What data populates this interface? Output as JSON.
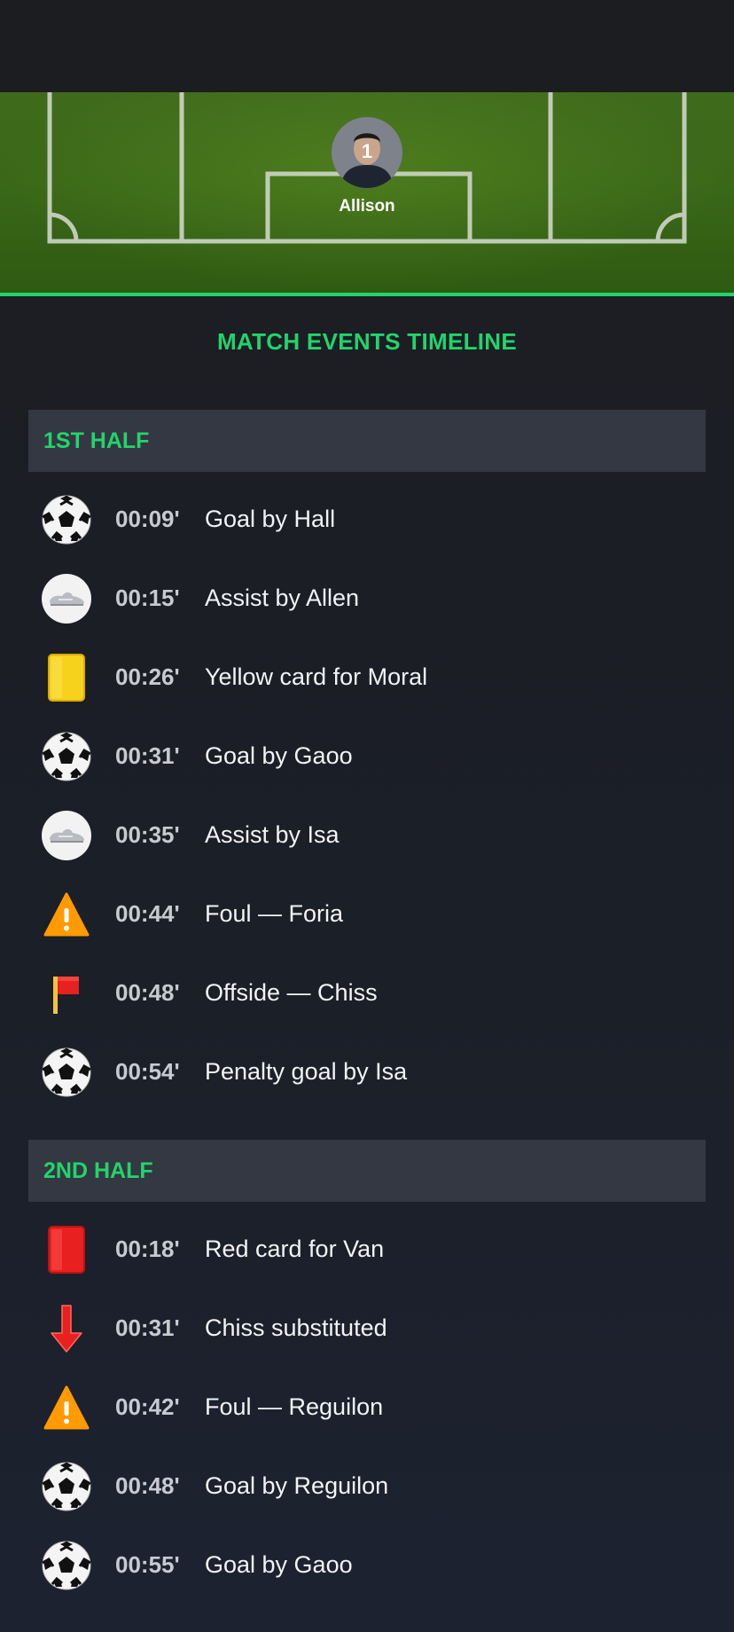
{
  "player": {
    "name": "Allison",
    "number": "1"
  },
  "timeline": {
    "title": "MATCH EVENTS TIMELINE"
  },
  "halves": [
    {
      "label": "1ST HALF",
      "events": [
        {
          "icon": "soccer-ball-icon",
          "time": "00:09'",
          "text": "Goal by Hall"
        },
        {
          "icon": "boot-icon",
          "time": "00:15'",
          "text": "Assist by Allen"
        },
        {
          "icon": "yellow-card-icon",
          "time": "00:26'",
          "text": "Yellow card for Moral"
        },
        {
          "icon": "soccer-ball-icon",
          "time": "00:31'",
          "text": "Goal by Gaoo"
        },
        {
          "icon": "boot-icon",
          "time": "00:35'",
          "text": "Assist by Isa"
        },
        {
          "icon": "warning-icon",
          "time": "00:44'",
          "text": "Foul — Foria"
        },
        {
          "icon": "offside-flag-icon",
          "time": "00:48'",
          "text": "Offside — Chiss"
        },
        {
          "icon": "soccer-ball-icon",
          "time": "00:54'",
          "text": "Penalty goal by Isa"
        }
      ]
    },
    {
      "label": "2ND HALF",
      "events": [
        {
          "icon": "red-card-icon",
          "time": "00:18'",
          "text": "Red card for Van"
        },
        {
          "icon": "substitution-down-arrow-icon",
          "time": "00:31'",
          "text": "Chiss substituted"
        },
        {
          "icon": "warning-icon",
          "time": "00:42'",
          "text": "Foul — Reguilon"
        },
        {
          "icon": "soccer-ball-icon",
          "time": "00:48'",
          "text": "Goal by Reguilon"
        },
        {
          "icon": "soccer-ball-icon",
          "time": "00:55'",
          "text": "Goal by Gaoo"
        }
      ]
    }
  ],
  "colors": {
    "accent": "#22d46b",
    "background": "#1c1d22",
    "section_header": "#343842",
    "time_text": "#c7cad1",
    "yellow_card": "#f7d21a",
    "red_card": "#e8201f",
    "warning": "#ff9a00"
  }
}
